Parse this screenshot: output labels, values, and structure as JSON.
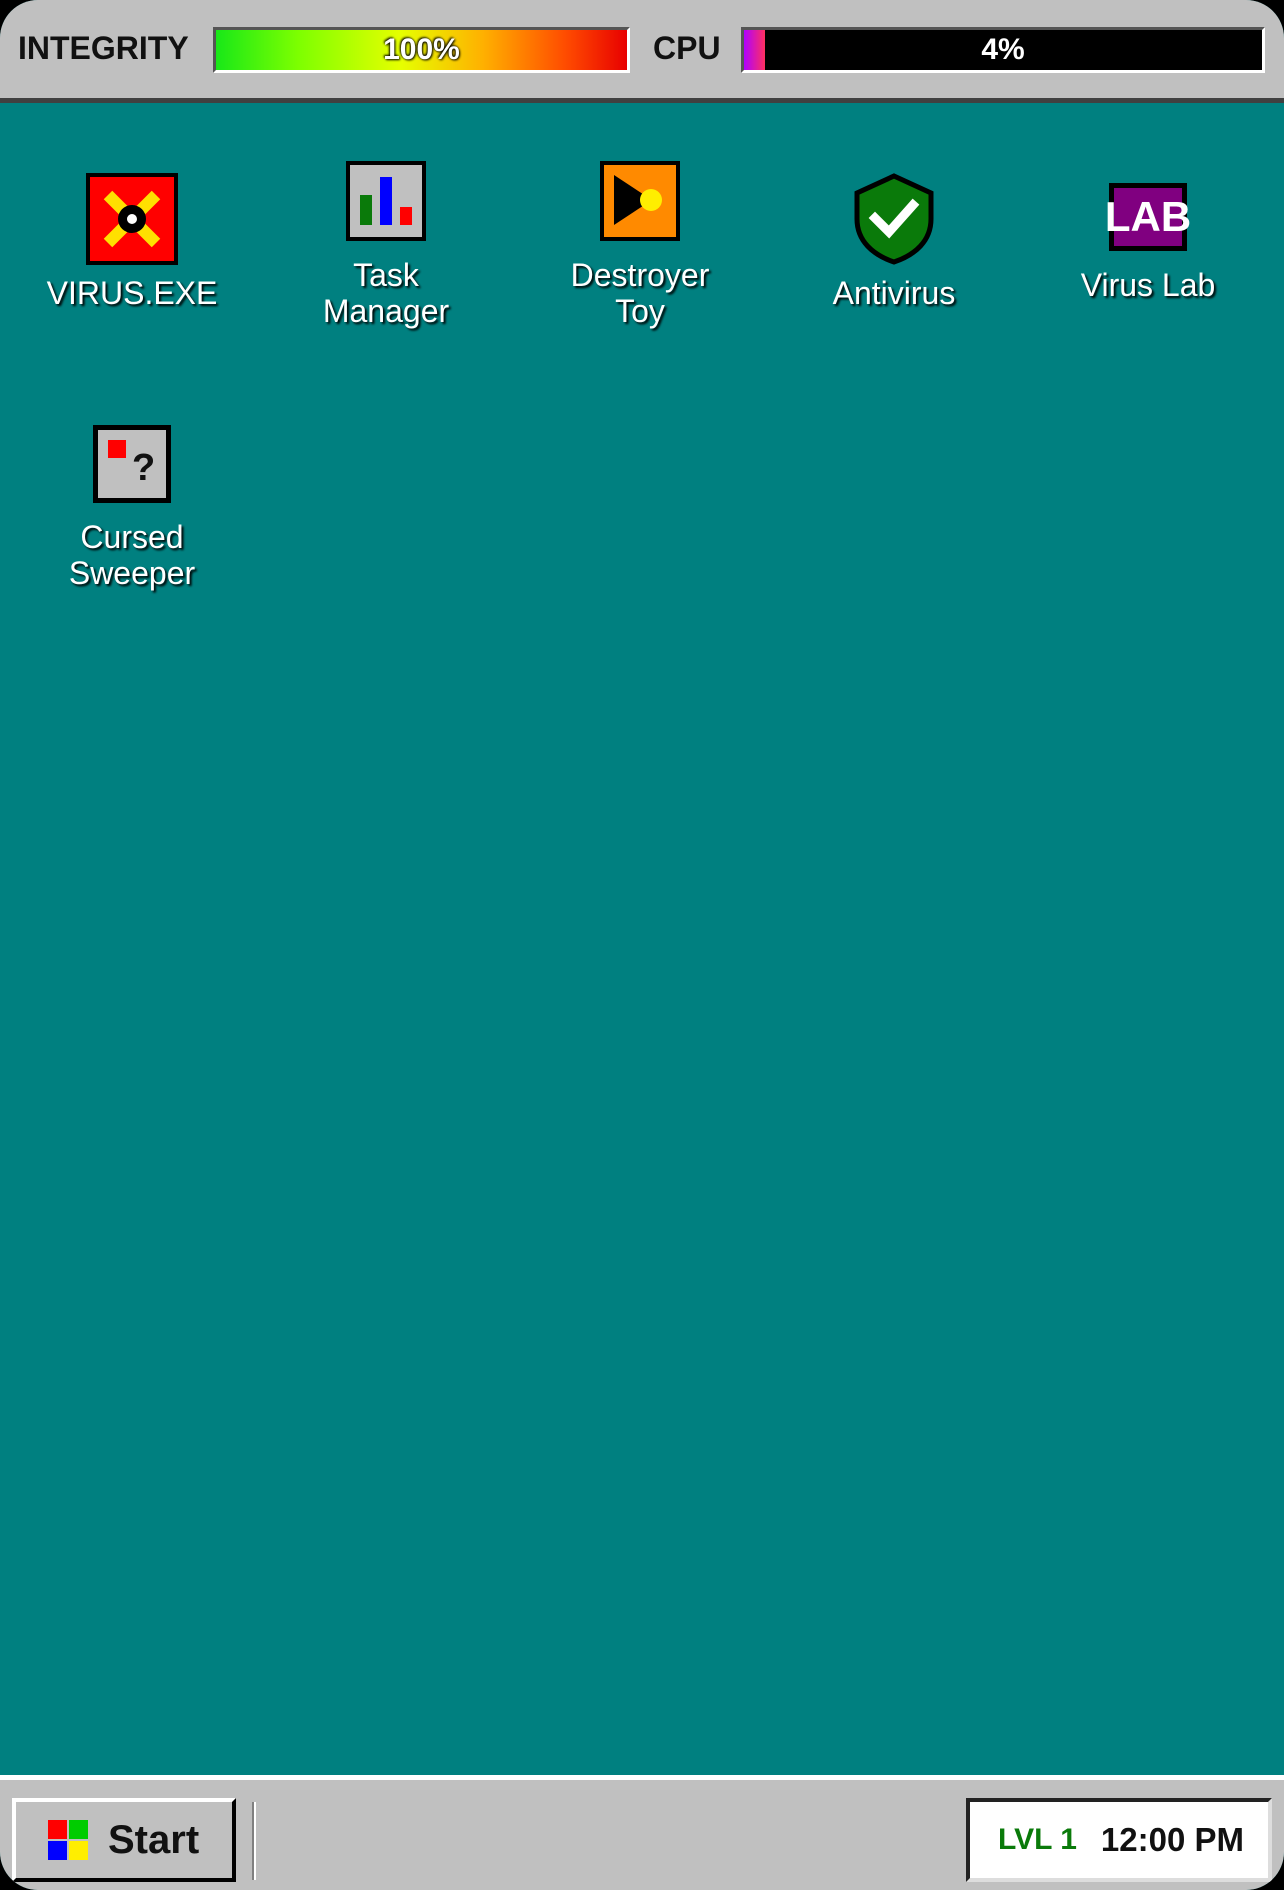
{
  "status": {
    "integrity_label": "INTEGRITY",
    "integrity_value": "100%",
    "integrity_percent": 100,
    "cpu_label": "CPU",
    "cpu_value": "4%",
    "cpu_percent": 4
  },
  "desktop": {
    "icons": [
      {
        "label": "VIRUS.EXE",
        "icon": "virus-icon"
      },
      {
        "label": "Task\nManager",
        "icon": "bar-chart-icon"
      },
      {
        "label": "Destroyer\nToy",
        "icon": "pacman-icon"
      },
      {
        "label": "Antivirus",
        "icon": "shield-check-icon"
      },
      {
        "label": "Virus Lab",
        "icon": "lab-icon",
        "glyph_text": "LAB"
      },
      {
        "label": "Cursed\nSweeper",
        "icon": "minesweeper-icon",
        "glyph_text": "?"
      }
    ]
  },
  "taskbar": {
    "start_label": "Start",
    "level": "LVL 1",
    "clock": "12:00 PM"
  },
  "colors": {
    "desktop": "#008080",
    "chrome": "#c0c0c0",
    "level_text": "#0a7a0a"
  }
}
